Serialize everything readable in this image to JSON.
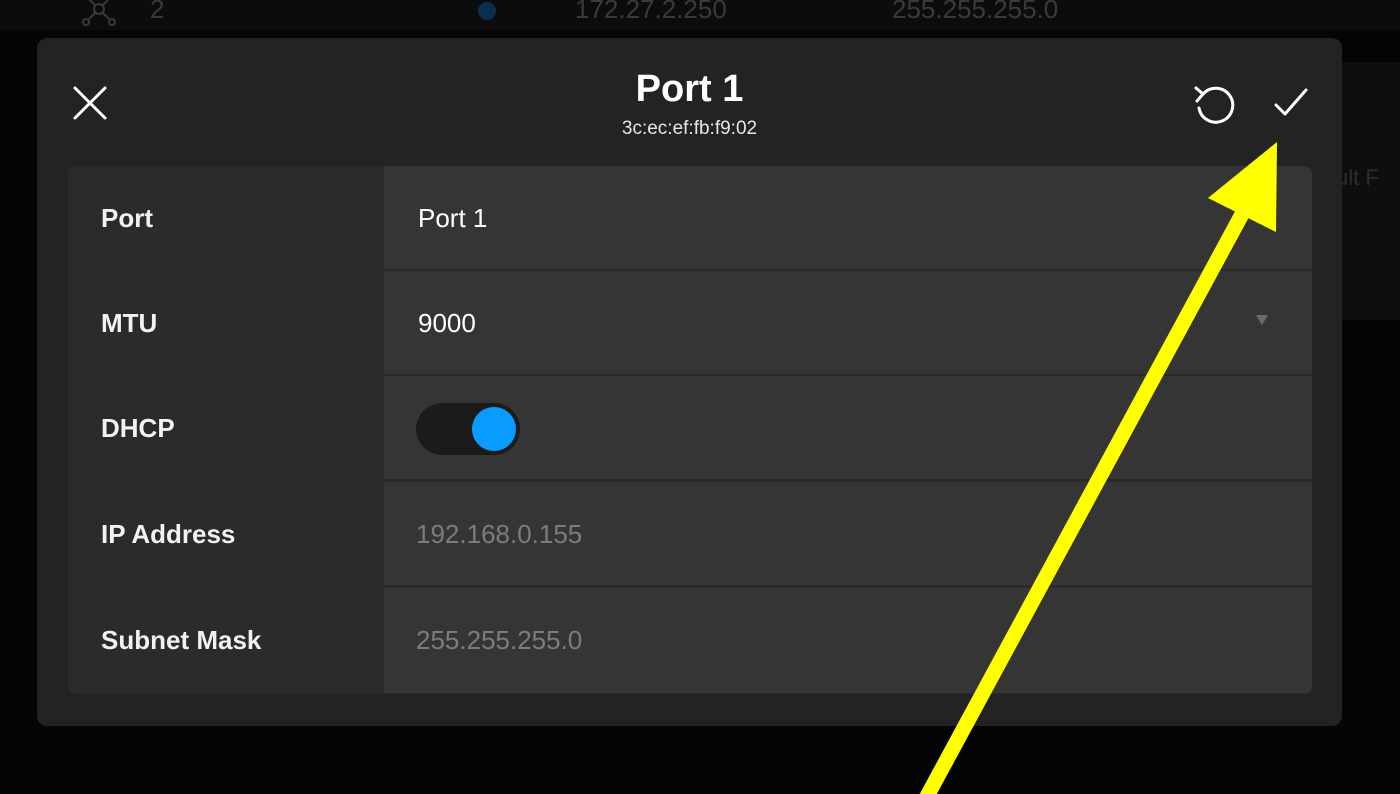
{
  "background": {
    "row": {
      "index": "2",
      "ip": "172.27.2.250",
      "mask": "255.255.255.0"
    },
    "side_text": "ult F"
  },
  "dialog": {
    "title": "Port 1",
    "subtitle": "3c:ec:ef:fb:f9:02",
    "icons": {
      "close": "close-icon",
      "reset": "refresh-icon",
      "confirm": "checkmark-icon"
    },
    "fields": {
      "port": {
        "label": "Port",
        "value": "Port 1"
      },
      "mtu": {
        "label": "MTU",
        "value": "9000"
      },
      "dhcp": {
        "label": "DHCP",
        "enabled": true
      },
      "ip_address": {
        "label": "IP Address",
        "value": "192.168.0.155"
      },
      "subnet_mask": {
        "label": "Subnet Mask",
        "value": "255.255.255.0"
      }
    }
  },
  "colors": {
    "accent": "#0a9bff",
    "annotation": "#ffff00",
    "dialog_bg": "#232323"
  }
}
